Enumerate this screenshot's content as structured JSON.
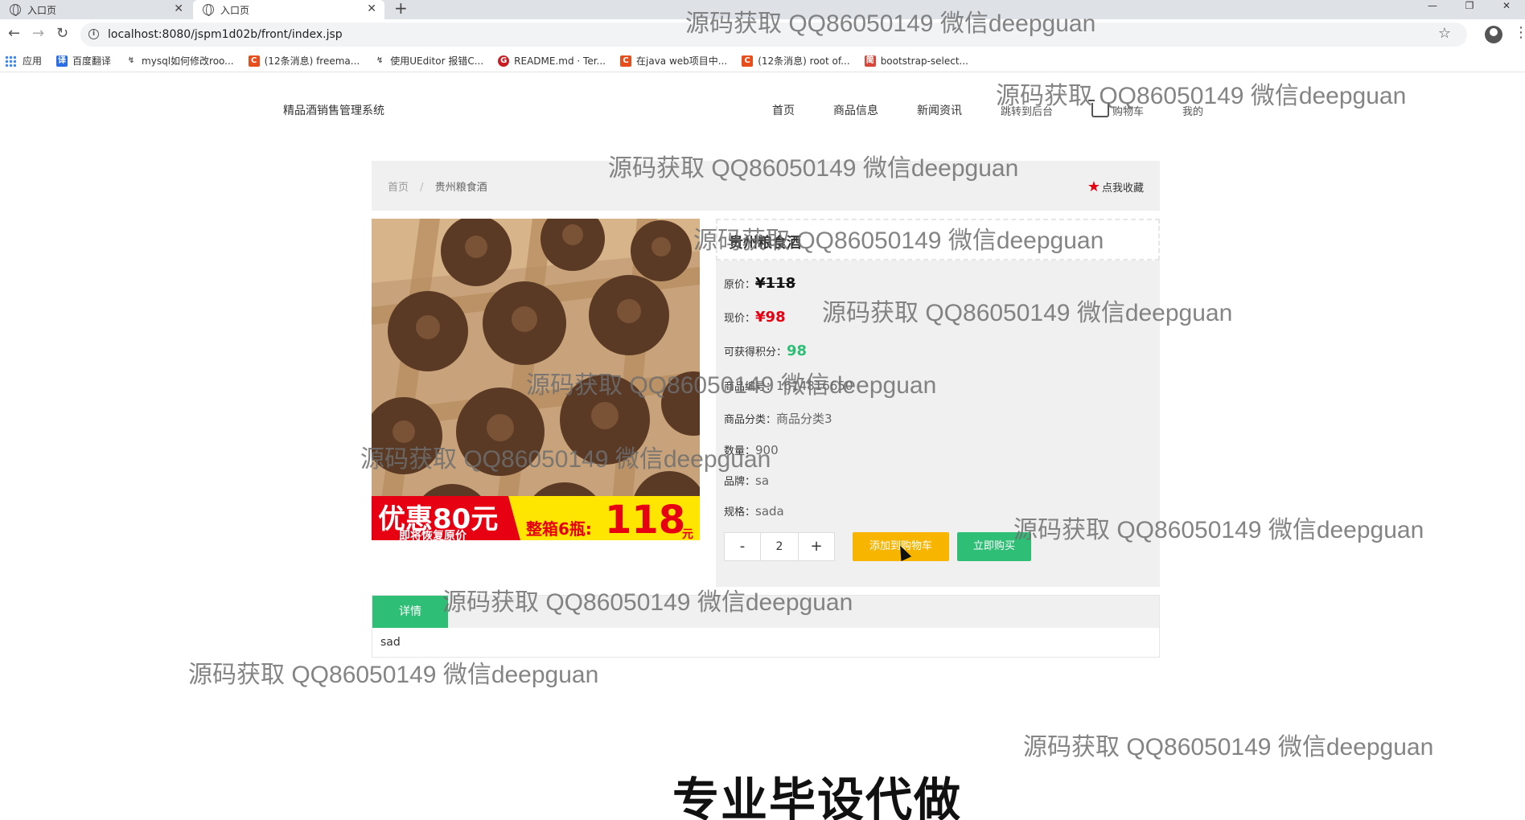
{
  "browser": {
    "tabs": [
      {
        "title": "入口页"
      },
      {
        "title": "入口页"
      }
    ],
    "new_tab": "+",
    "url": "localhost:8080/jspm1d02b/front/index.jsp",
    "bookmarks": [
      {
        "label": "应用",
        "color": "#4285f4",
        "icon": "apps-icon"
      },
      {
        "label": "百度翻译",
        "color": "#2b6de5",
        "icon": "translate-icon"
      },
      {
        "label": "mysql如何修改roo...",
        "color": "#555555",
        "icon": "link-icon"
      },
      {
        "label": "(12条消息) freema...",
        "color": "#e84e1b",
        "icon": "csdn-icon"
      },
      {
        "label": "使用UEditor 报错C...",
        "color": "#555555",
        "icon": "link-icon"
      },
      {
        "label": "README.md · Ter...",
        "color": "#c71d23",
        "icon": "gitee-icon"
      },
      {
        "label": "在java web项目中...",
        "color": "#e84e1b",
        "icon": "csdn-icon"
      },
      {
        "label": "(12条消息) root of...",
        "color": "#e84e1b",
        "icon": "csdn-icon"
      },
      {
        "label": "bootstrap-select...",
        "color": "#d9473a",
        "icon": "jianshu-icon"
      }
    ]
  },
  "site": {
    "logo": "精品酒销售管理系统",
    "nav": [
      "首页",
      "商品信息",
      "新闻资讯",
      "跳转到后台",
      "购物车",
      "我的"
    ]
  },
  "breadcrumb": {
    "home": "首页",
    "separator": "/",
    "current": "贵州粮食酒"
  },
  "favorite": {
    "label": "点我收藏",
    "icon": "star-icon",
    "color": "#e60012"
  },
  "product": {
    "name": "贵州粮食酒",
    "original_price_label": "原价：",
    "original_price": "¥118",
    "current_price_label": "现价：",
    "current_price": "¥98",
    "points_label": "可获得积分：",
    "points": "98",
    "code_label": "商品编号：",
    "code": "1614816650",
    "category_label": "商品分类：",
    "category": "商品分类3",
    "stock_label": "数量：",
    "stock": "900",
    "brand_label": "品牌：",
    "brand": "sa",
    "spec_label": "规格：",
    "spec": "sada",
    "image_promo": "优惠80元",
    "image_promo_sub": "即将恢复原价",
    "image_box": "整箱6瓶:",
    "image_price": "118",
    "image_unit": "元"
  },
  "purchase": {
    "minus": "-",
    "quantity": "2",
    "plus": "+",
    "add_to_cart": "添加到购物车",
    "buy_now": "立即购买"
  },
  "detail": {
    "tab": "详情",
    "content": "sad"
  },
  "watermark": "源码获取 QQ86050149 微信deepguan",
  "banner": "专业毕设代做",
  "colors": {
    "accent_green": "#2fbe76",
    "accent_yellow": "#f7b500",
    "price_red": "#e60012"
  }
}
